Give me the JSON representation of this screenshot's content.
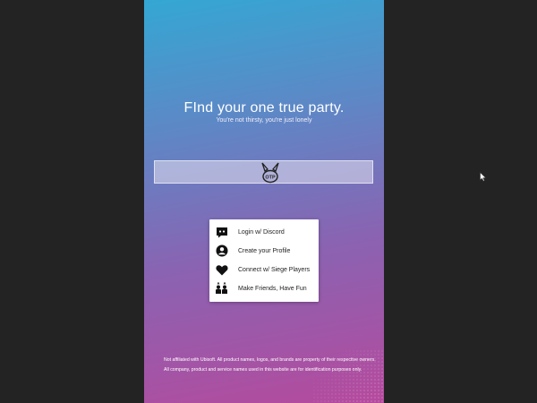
{
  "hero": {
    "title": "FInd your one true party.",
    "subtitle": "You're not thirsty, you're just lonely"
  },
  "logo": {
    "text": "OTP",
    "icon": "bunny-logo-icon"
  },
  "features": [
    {
      "icon": "discord-icon",
      "label": "Login w/ Discord"
    },
    {
      "icon": "profile-icon",
      "label": "Create your Profile"
    },
    {
      "icon": "heart-icon",
      "label": "Connect w/ Siege Players"
    },
    {
      "icon": "friends-icon",
      "label": "Make Friends, Have Fun"
    }
  ],
  "footer": {
    "disclaimer": "Not affiliated with Ubisoft. All product names, logos, and brands are property of their respective owners. All company, product and service names used in this website are for identification purposes only."
  },
  "colors": {
    "gradient_top": "#34a7d3",
    "gradient_bottom": "#b54a9d",
    "side_background": "#232323",
    "card_background": "#ffffff"
  }
}
